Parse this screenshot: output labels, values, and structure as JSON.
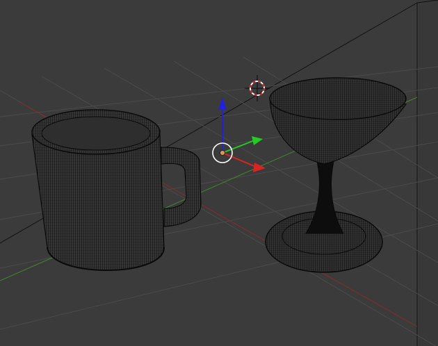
{
  "viewport": {
    "mode": "wireframe",
    "background": "#3b3b3b",
    "grid_color": "#4a4a4a",
    "wire_color": "#0a0a0a",
    "x_axis_color": "#8a2a2a",
    "y_axis_color": "#3f8a2a"
  },
  "scene": {
    "objects": [
      {
        "name": "mug",
        "kind": "mug-icon"
      },
      {
        "name": "martini-glass",
        "kind": "glass-icon"
      },
      {
        "name": "backdrop-plane",
        "kind": "plane-icon"
      }
    ],
    "cursor": {
      "kind": "3d-cursor-icon",
      "color": "#cc2222"
    },
    "gizmo": {
      "kind": "transform-gizmo-icon",
      "x_color": "#dd2222",
      "y_color": "#22cc22",
      "z_color": "#2222dd",
      "origin_color": "#d89a4a"
    }
  }
}
